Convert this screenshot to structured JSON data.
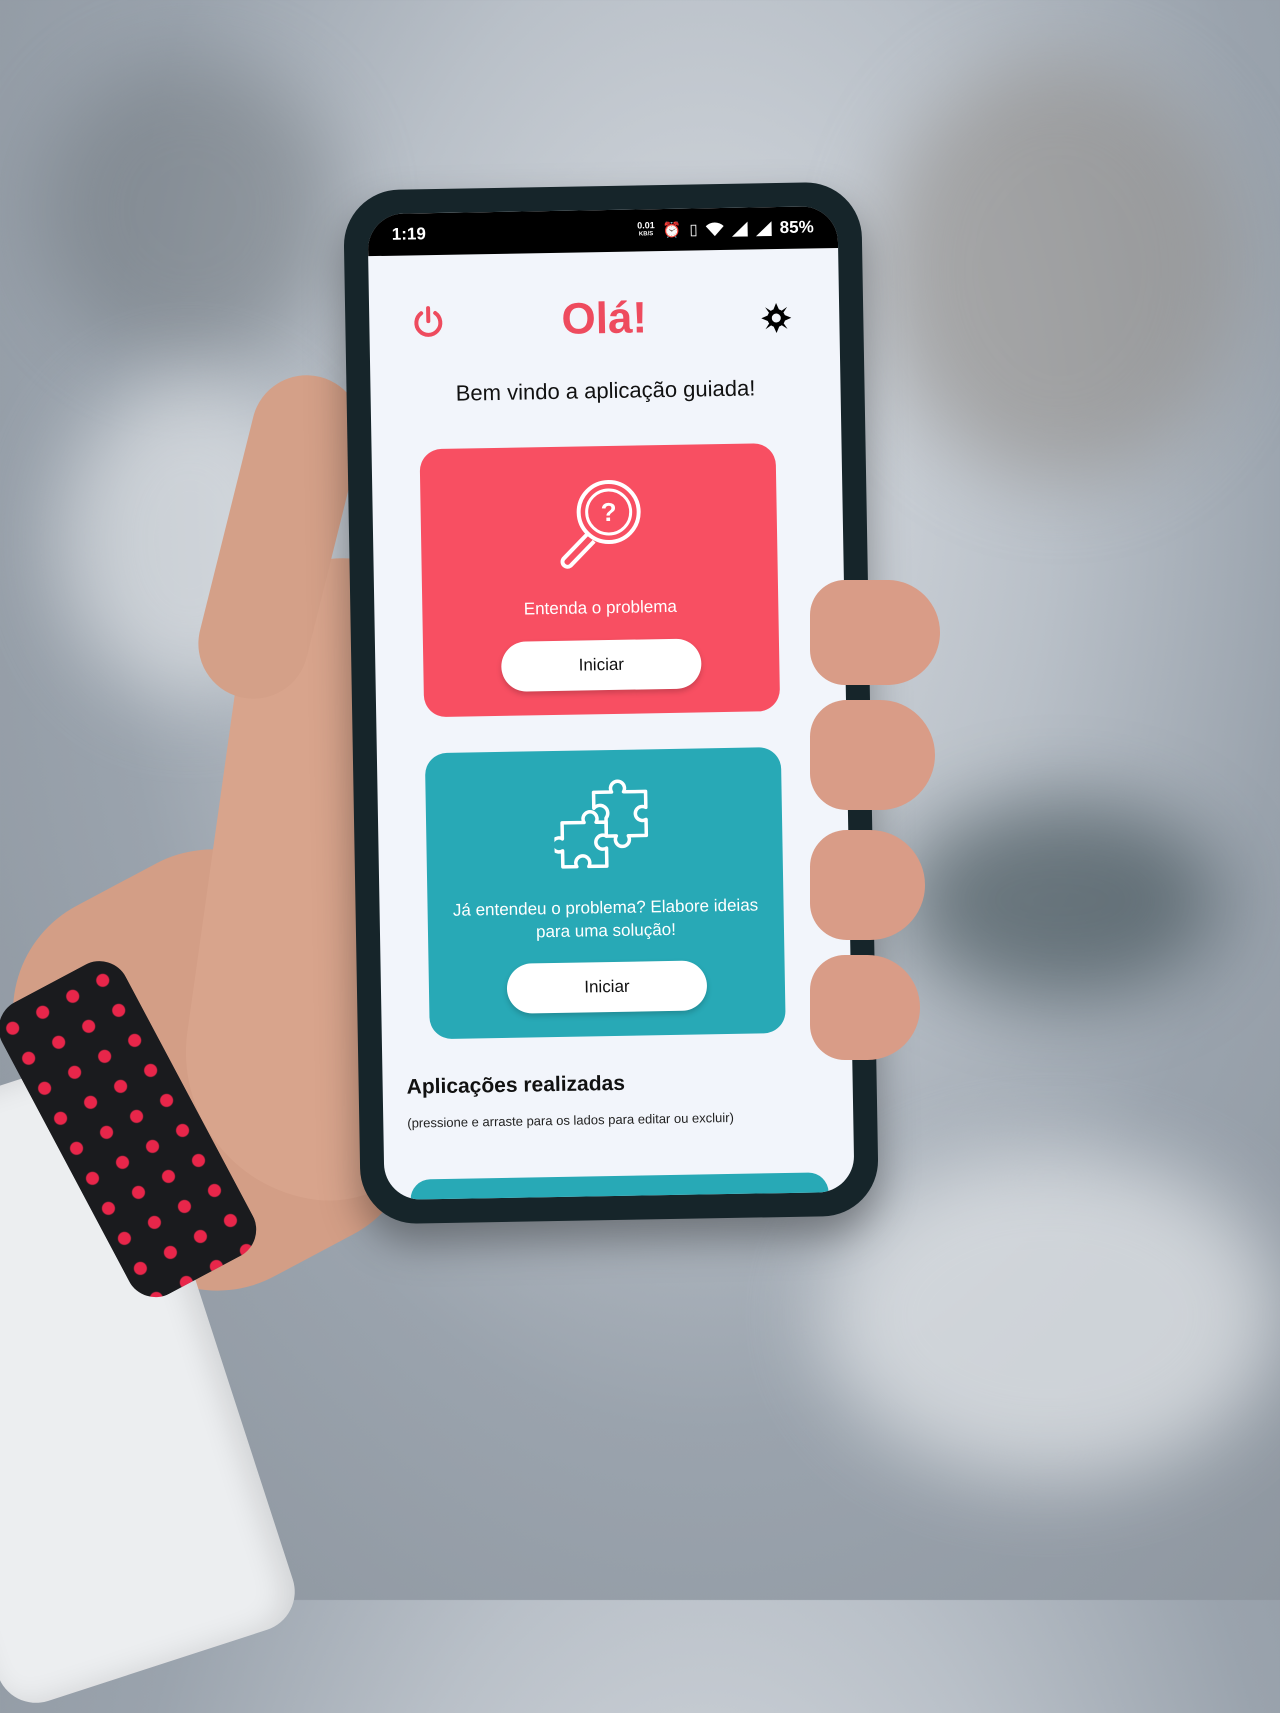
{
  "statusbar": {
    "time": "1:19",
    "net_speed": "0.01",
    "net_unit": "KB/S",
    "battery": "85%"
  },
  "header": {
    "title": "Olá!",
    "subtitle": "Bem vindo a aplicação guiada!"
  },
  "cards": [
    {
      "text": "Entenda o problema",
      "button_label": "Iniciar",
      "color": "#f84f62",
      "icon": "magnifier-question-icon"
    },
    {
      "text": "Já entendeu o problema? Elabore ideias para uma solução!",
      "button_label": "Iniciar",
      "color": "#28a9b6",
      "icon": "puzzle-icon"
    }
  ],
  "applications": {
    "title": "Aplicações realizadas",
    "hint": "(pressione e arraste para os lados para editar ou excluir)"
  },
  "colors": {
    "accent": "#ee4b5e",
    "teal": "#28a9b6",
    "screen_bg": "#f2f5fb"
  }
}
